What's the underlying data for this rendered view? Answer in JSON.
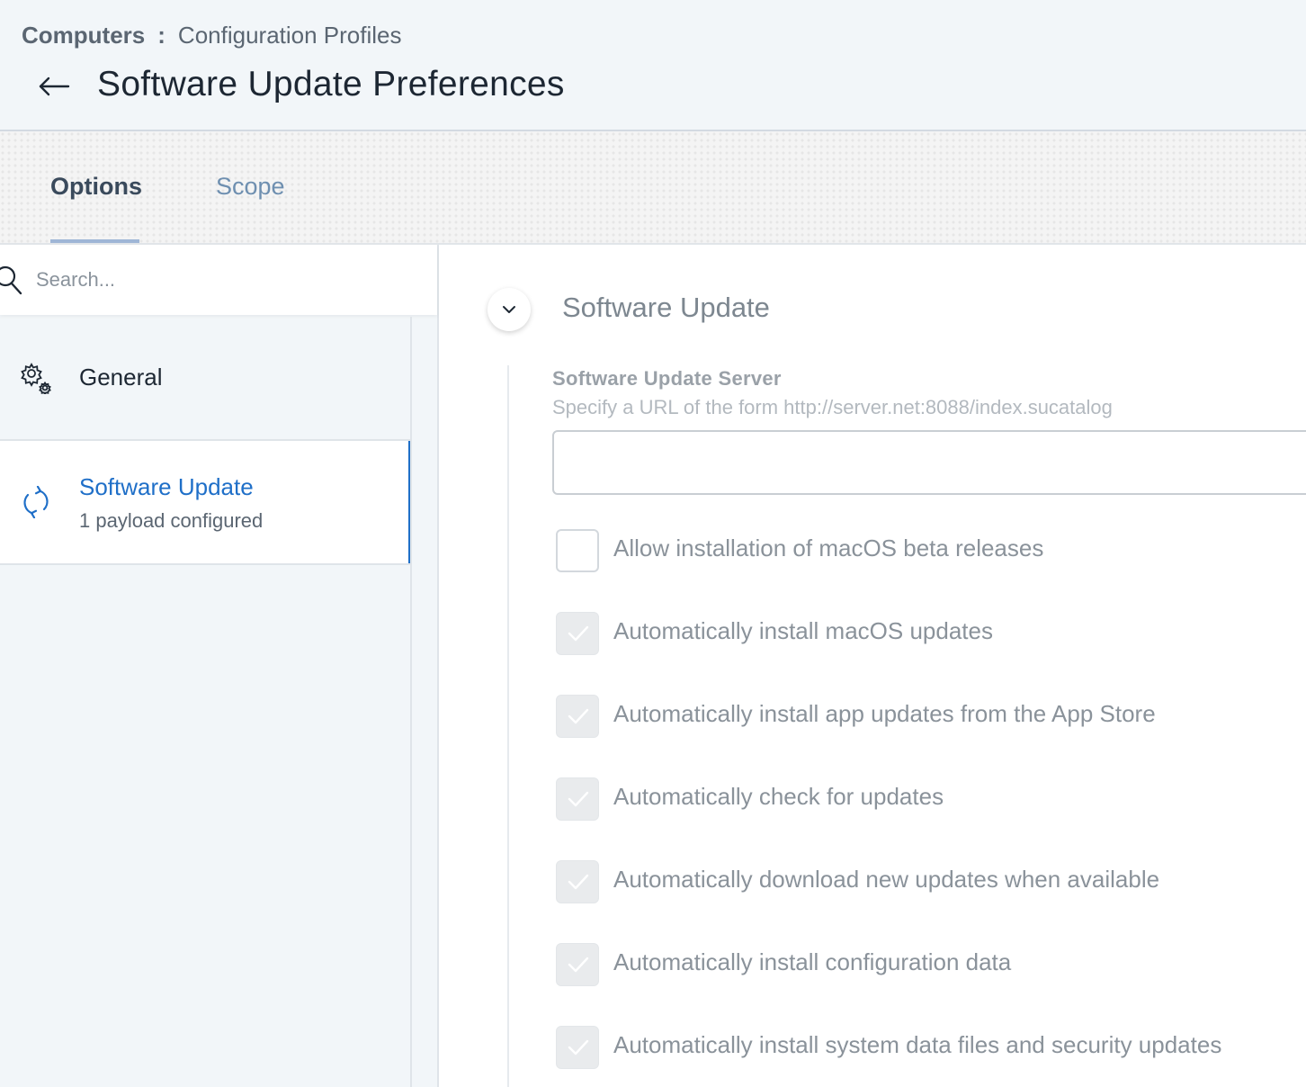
{
  "breadcrumb": {
    "root": "Computers",
    "separator": ":",
    "current": "Configuration Profiles"
  },
  "page": {
    "title": "Software Update Preferences"
  },
  "tabs": [
    {
      "label": "Options",
      "active": true
    },
    {
      "label": "Scope",
      "active": false
    }
  ],
  "sidebar": {
    "search_placeholder": "Search...",
    "items": [
      {
        "label": "General",
        "icon": "gears-icon"
      },
      {
        "label": "Software Update",
        "sub": "1 payload configured",
        "icon": "sync-icon",
        "active": true
      }
    ]
  },
  "section": {
    "title": "Software Update",
    "server_label": "Software Update Server",
    "server_help": "Specify a URL of the form http://server.net:8088/index.sucatalog",
    "server_value": "",
    "options": [
      {
        "label": "Allow installation of macOS beta releases",
        "checked": false
      },
      {
        "label": "Automatically install macOS updates",
        "checked": true
      },
      {
        "label": "Automatically install app updates from the App Store",
        "checked": true
      },
      {
        "label": "Automatically check for updates",
        "checked": true
      },
      {
        "label": "Automatically download new updates when available",
        "checked": true
      },
      {
        "label": "Automatically install configuration data",
        "checked": true
      },
      {
        "label": "Automatically install system data files and security updates",
        "checked": true
      }
    ]
  },
  "colors": {
    "accent": "#1f6fc8",
    "tab_underline": "#9fb6d6"
  }
}
